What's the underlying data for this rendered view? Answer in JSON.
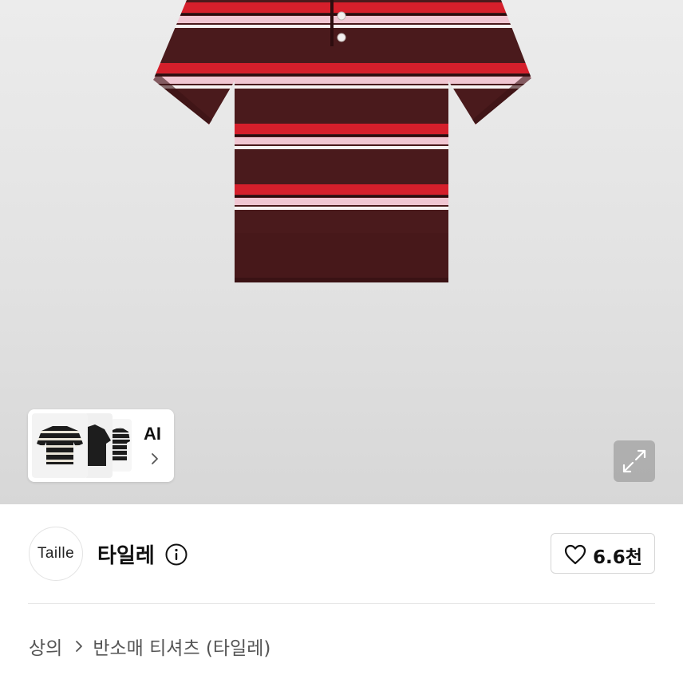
{
  "ai_preview": {
    "label": "AI",
    "thumbnail_icons": [
      "striped-shirt-thumb-icon",
      "black-shirt-thumb-icon",
      "striped-shirt-thumb-icon"
    ]
  },
  "expand_button": {
    "icon": "expand-arrows-icon"
  },
  "shop": {
    "avatar_text": "Taille",
    "name": "타일레",
    "info_icon": "info-icon",
    "like_icon": "heart-outline-icon",
    "like_count": "6.6천"
  },
  "breadcrumb": {
    "level1": "상의",
    "separator_icon": "chevron-right-icon",
    "level2": "반소매 티셔츠 (타일레)"
  },
  "colors": {
    "shirt_base": "#4a1a1c",
    "stripe_red": "#d51f2b",
    "stripe_pink": "#f1c6d2",
    "stripe_white": "#f7f2f2"
  }
}
